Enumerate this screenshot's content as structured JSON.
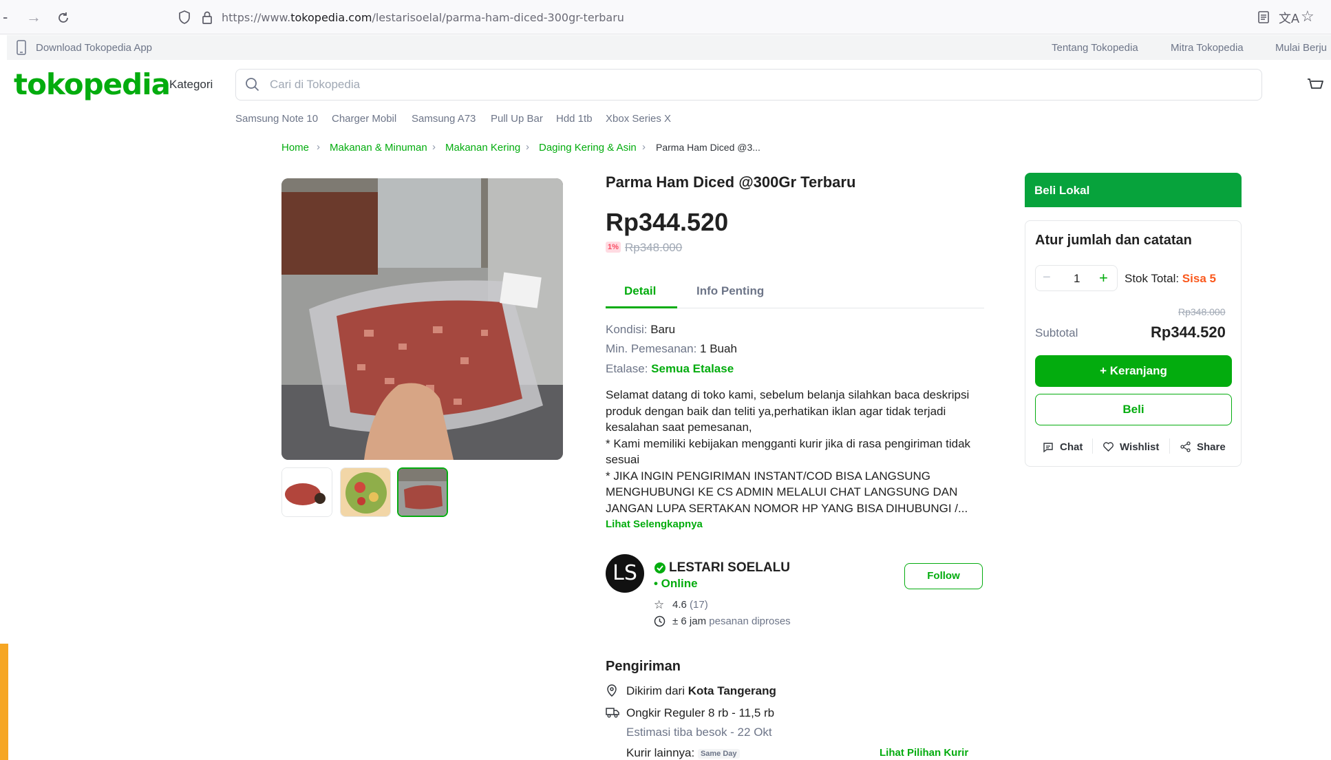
{
  "browser": {
    "url_prefix": "https://www.",
    "url_domain": "tokopedia.com",
    "url_path": "/lestarisoelal/parma-ham-diced-300gr-terbaru"
  },
  "topstrip": {
    "download_app": "Download Tokopedia App",
    "links": [
      "Tentang Tokopedia",
      "Mitra Tokopedia",
      "Mulai Berju"
    ]
  },
  "header": {
    "logo": "tokopedia",
    "kategori": "Kategori",
    "search_placeholder": "Cari di Tokopedia",
    "chips": [
      "Samsung Note 10",
      "Charger Mobil",
      "Samsung A73",
      "Pull Up Bar",
      "Hdd 1tb",
      "Xbox Series X"
    ]
  },
  "breadcrumb": [
    "Home",
    "Makanan & Minuman",
    "Makanan Kering",
    "Daging Kering & Asin",
    "Parma Ham Diced @3..."
  ],
  "product": {
    "title": "Parma Ham Diced @300Gr Terbaru",
    "price": "Rp344.520",
    "discount": "1%",
    "original_price": "Rp348.000",
    "tabs": [
      "Detail",
      "Info Penting"
    ],
    "kondisi_label": "Kondisi: ",
    "kondisi_value": "Baru",
    "min_label": "Min. Pemesanan: ",
    "min_value": "1 Buah",
    "etalase_label": "Etalase: ",
    "etalase_value": "Semua Etalase",
    "description": "Selamat datang di toko kami, sebelum belanja silahkan baca deskripsi produk dengan baik dan teliti ya,perhatikan iklan agar tidak terjadi kesalahan saat pemesanan,\n* Kami memiliki kebijakan mengganti kurir jika di rasa pengiriman tidak sesuai\n* JIKA INGIN PENGIRIMAN INSTANT/COD BISA LANGSUNG MENGHUBUNGI KE CS ADMIN MELALUI CHAT LANGSUNG DAN JANGAN LUPA SERTAKAN NOMOR HP YANG BISA DIHUBUNGI /...",
    "see_more": "Lihat Selengkapnya"
  },
  "shop": {
    "avatar_initials": "LS",
    "name": "LESTARI SOELALU",
    "status": "• Online",
    "follow": "Follow",
    "rating": "4.6",
    "rating_count": "(17)",
    "process_time": "± 6 jam",
    "process_suffix": "pesanan diproses"
  },
  "shipping": {
    "heading": "Pengiriman",
    "from_label": "Dikirim dari ",
    "from_city": "Kota Tangerang",
    "ongkir": "Ongkir Reguler 8 rb - 11,5 rb",
    "estimate": "Estimasi tiba besok - 22 Okt",
    "other_label": "Kurir lainnya: ",
    "same_day": "Same Day",
    "see_options": "Lihat Pilihan Kurir"
  },
  "cart_card": {
    "beli_lokal": "Beli Lokal",
    "title": "Atur jumlah dan catatan",
    "quantity": "1",
    "stock_label": "Stok Total: ",
    "stock_value": "Sisa 5",
    "subtotal_original": "Rp348.000",
    "subtotal_label": "Subtotal",
    "subtotal_value": "Rp344.520",
    "add_to_cart": "+ Keranjang",
    "buy": "Beli",
    "chat": "Chat",
    "wishlist": "Wishlist",
    "share": "Share"
  },
  "colors": {
    "brand": "#03ac0e",
    "stock_accent": "#fa591d",
    "discount_badge": "#f94d63"
  }
}
